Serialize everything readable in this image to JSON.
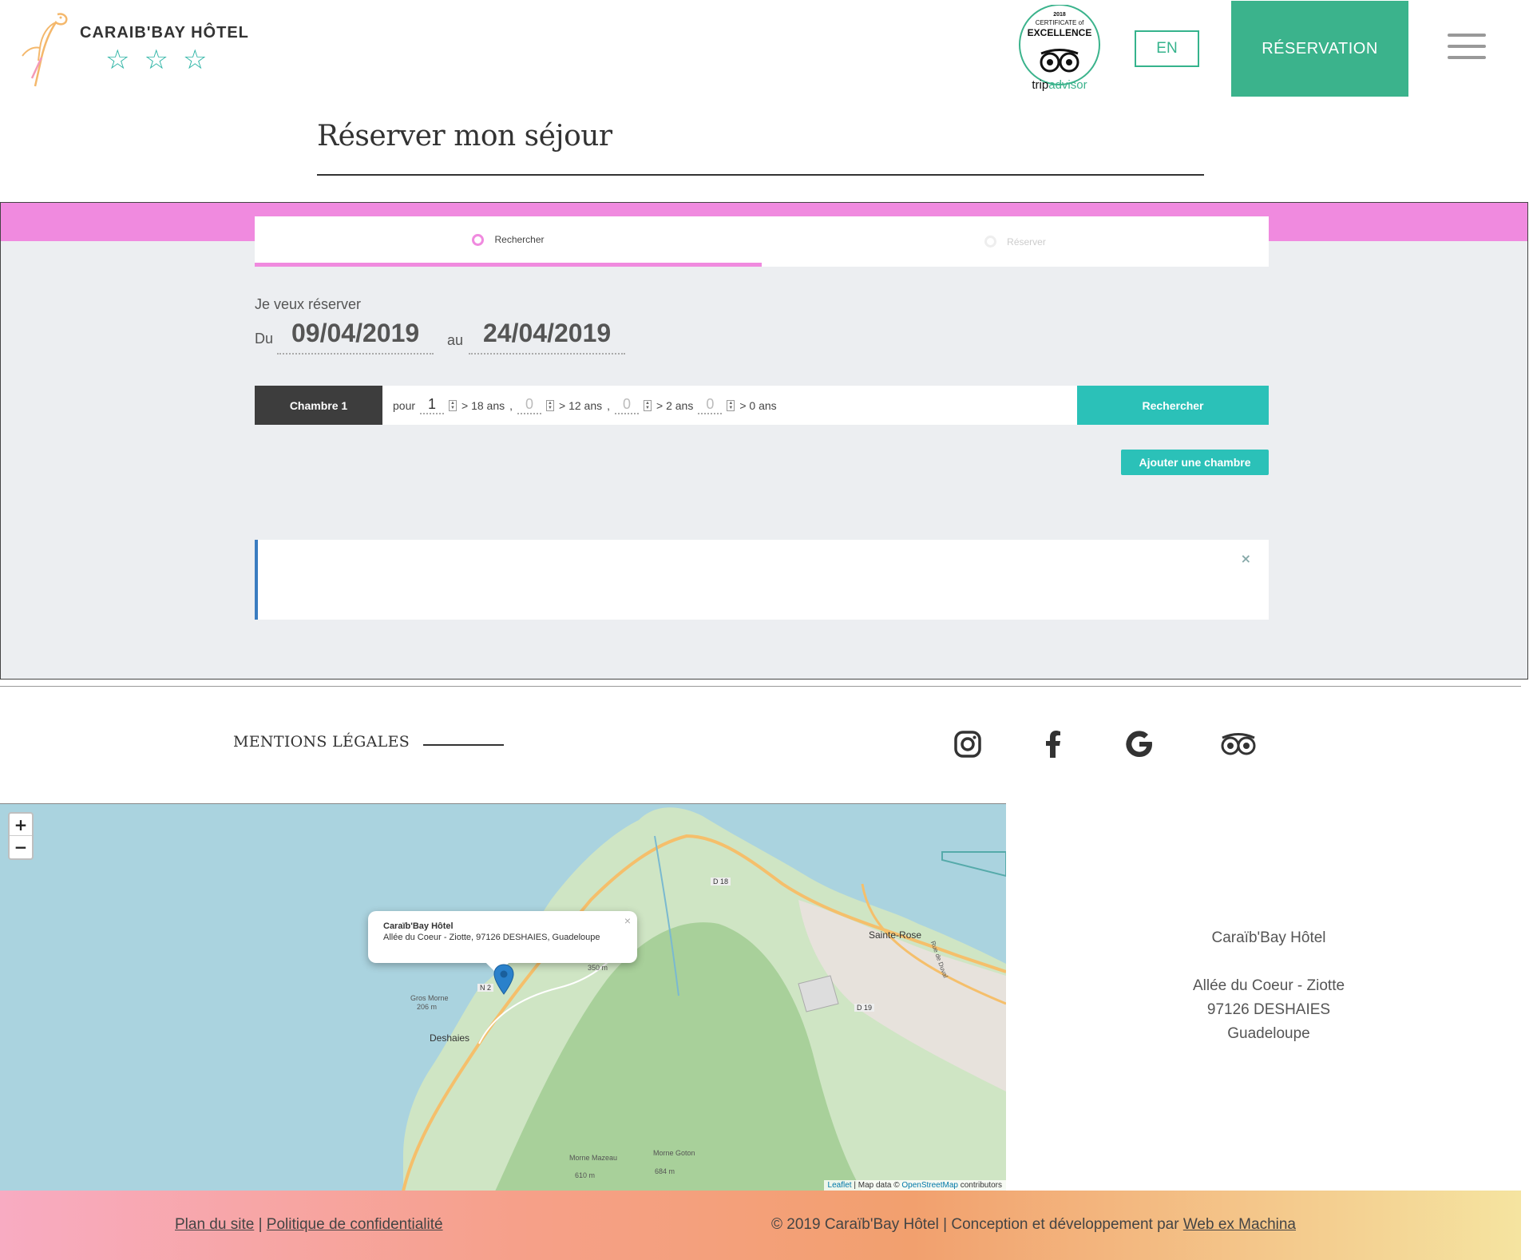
{
  "header": {
    "brand": "CARAIB'BAY HÔTEL",
    "stars": [
      "☆",
      "☆",
      "☆"
    ],
    "badge": {
      "year": "2018",
      "line1": "CERTIFICATE of",
      "line2": "EXCELLENCE",
      "brand_trip": "trip",
      "brand_advisor": "advisor"
    },
    "lang_label": "EN",
    "reservation_label": "RÉSERVATION",
    "menu_icon": "hamburger-icon"
  },
  "page": {
    "title": "Réserver mon séjour"
  },
  "booking": {
    "steps": [
      {
        "label": "Rechercher",
        "active": true
      },
      {
        "label": "Réserver",
        "active": false
      }
    ],
    "want_label": "Je veux réserver",
    "from_label": "Du",
    "from_date": "09/04/2019",
    "to_label": "au",
    "to_date": "24/04/2019",
    "room": {
      "label": "Chambre 1",
      "for_label": "pour",
      "occupants": [
        {
          "count": "1",
          "label": "> 18 ans",
          "sep": ","
        },
        {
          "count": "0",
          "label": "> 12 ans",
          "sep": ","
        },
        {
          "count": "0",
          "label": "> 2 ans",
          "sep": ""
        },
        {
          "count": "0",
          "label": "> 0 ans",
          "sep": ""
        }
      ]
    },
    "search_label": "Rechercher",
    "add_room_label": "Ajouter une chambre",
    "alert_close": "×"
  },
  "links": {
    "legal": "MENTIONS LÉGALES",
    "social": [
      "instagram-icon",
      "facebook-icon",
      "google-icon",
      "tripadvisor-icon"
    ]
  },
  "map": {
    "zoom_in": "+",
    "zoom_out": "−",
    "popup_title": "Caraïb'Bay Hôtel",
    "popup_address": "Allée du Coeur - Ziotte, 97126 DESHAIES, Guadeloupe",
    "popup_close": "×",
    "labels": {
      "sainte_rose": "Sainte-Rose",
      "deshaies": "Deshaies",
      "d18": "D 18",
      "d19": "D 19",
      "n2": "N 2",
      "gros_morne": "Gros Morne",
      "gros_morne_alt": "206 m",
      "morne_mazeau": "Morne Mazeau",
      "morne_mazeau_alt": "610 m",
      "morne_goton": "Morne Goton",
      "morne_goton_alt": "684 m",
      "alt_350": "350 m",
      "rue": "Rue de Duval"
    },
    "attribution_leaflet": "Leaflet",
    "attribution_mid": "| Map data ©",
    "attribution_osm": "OpenStreetMap",
    "attribution_end": "contributors"
  },
  "address": {
    "name": "Caraïb'Bay Hôtel",
    "line1": "Allée du Coeur - Ziotte",
    "line2": "97126 DESHAIES",
    "line3": "Guadeloupe"
  },
  "footer": {
    "sitemap": "Plan du site",
    "divider": "|",
    "privacy": "Politique de confidentialité",
    "copyright": "© 2019 Caraïb'Bay Hôtel | Conception et développement par",
    "agency": "Web ex Machina"
  },
  "colors": {
    "accent_green": "#3bb38c",
    "accent_teal": "#2bc1b8",
    "accent_pink": "#f08adf",
    "alert_blue": "#3a7cc0"
  }
}
